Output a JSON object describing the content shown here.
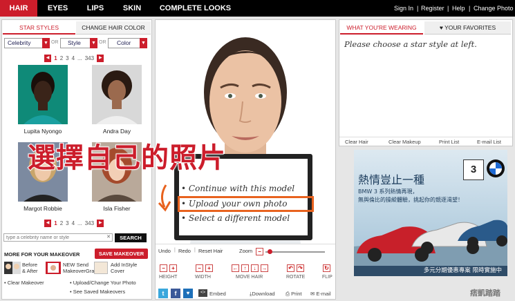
{
  "nav": {
    "tabs": [
      "HAIR",
      "EYES",
      "LIPS",
      "SKIN",
      "COMPLETE LOOKS"
    ],
    "account": [
      "Sign In",
      "Register",
      "Help",
      "Change Photo"
    ]
  },
  "left": {
    "tabs": [
      "STAR STYLES",
      "CHANGE HAIR COLOR"
    ],
    "filters": [
      "Celebrity",
      "Style",
      "Color"
    ],
    "or_label": "OR",
    "pages": [
      "1",
      "2",
      "3",
      "4",
      "...",
      "343"
    ],
    "stars": [
      "Lupita Nyongo",
      "Andra Day",
      "Margot Robbie",
      "Isla Fisher"
    ],
    "search_placeholder": "type a celebrity name or style",
    "search_button": "SEARCH",
    "makeover_title": "MORE FOR YOUR MAKEOVER",
    "save_makeover": "SAVE MAKEOVER",
    "makeover_items": [
      "Before & After",
      "NEW Send MakeoverGram",
      "Add InStyle Cover"
    ],
    "links": [
      "Clear Makeover",
      "Upload/Change Your Photo",
      "See Saved Makeovers"
    ]
  },
  "center": {
    "overlay_title": "選擇自己的照片",
    "menu": [
      "Continue with this model",
      "Upload your own photo",
      "Select a different model"
    ],
    "toolbar": {
      "undo": "Undo",
      "redo": "Redo",
      "reset": "Reset Hair",
      "zoom": "Zoom"
    },
    "controls": [
      "HEIGHT",
      "WIDTH",
      "MOVE HAIR",
      "ROTATE",
      "FLIP"
    ],
    "share": {
      "embed": "Embed",
      "download": "Download",
      "print": "Print",
      "email": "E-mail"
    }
  },
  "right": {
    "tabs": [
      "WHAT YOU'RE WEARING",
      "YOUR FAVORITES"
    ],
    "message": "Please choose a star style at left.",
    "links": [
      "Clear Hair",
      "Clear Makeup",
      "Print List",
      "E-mail List"
    ]
  },
  "ad": {
    "headline": "熱情豈止一種",
    "sub1": "BMW 3 系列熱情再現，",
    "sub2": "無與倫比的操縱體驗，挑起你的競逐渴望！",
    "bar": "多元分期優惠專案 限時實施中",
    "badge": "3"
  },
  "watermark": "痞凱踏踏",
  "colors": {
    "brand": "#cc1d2b",
    "nav_bg": "#000000",
    "highlight": "#e8621e"
  }
}
